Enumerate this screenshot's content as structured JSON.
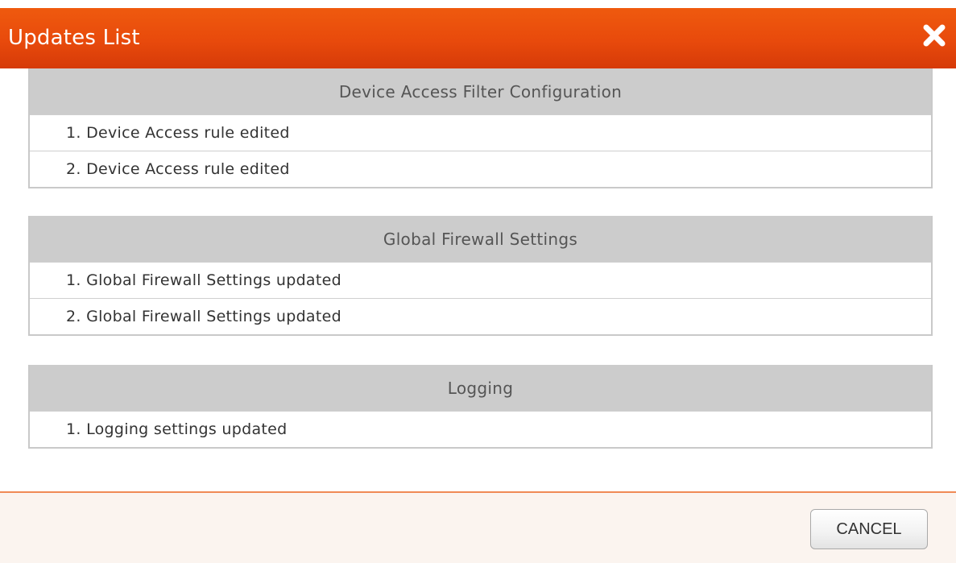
{
  "dialog": {
    "title": "Updates List",
    "close_icon": "close-icon",
    "cancel_label": "CANCEL"
  },
  "sections": [
    {
      "title": "Device Access Filter Configuration",
      "items": [
        "1. Device Access rule edited",
        "2. Device Access rule edited"
      ]
    },
    {
      "title": "Global Firewall Settings",
      "items": [
        "1. Global Firewall Settings updated",
        "2. Global Firewall Settings updated"
      ]
    },
    {
      "title": "Logging",
      "items": [
        "1. Logging settings updated"
      ]
    }
  ],
  "colors": {
    "header": "#e84a0c",
    "section_header": "#cccccc",
    "footer_border": "#f08a55"
  }
}
